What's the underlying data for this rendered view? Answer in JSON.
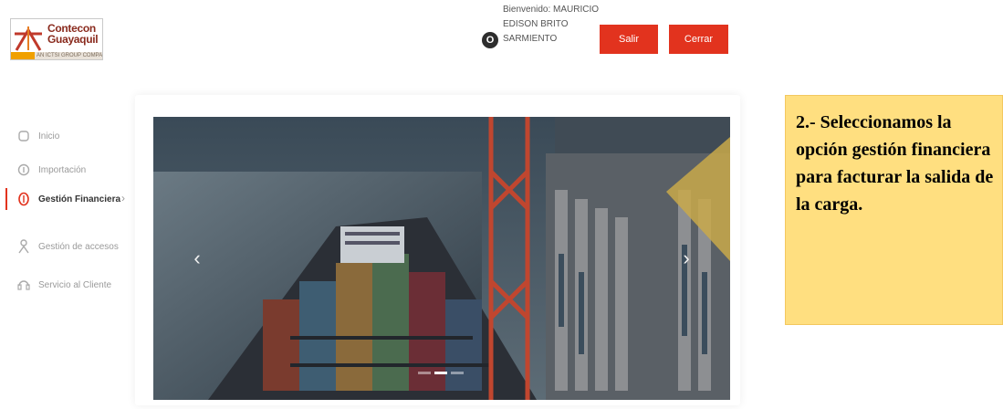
{
  "header": {
    "logo": {
      "line1": "Contecon",
      "line2": "Guayaquil",
      "tagline": "AN ICTSI GROUP COMPANY"
    },
    "user": {
      "avatar_letter": "O",
      "lines": [
        "Bienvenido: MAURICIO",
        "EDISON BRITO",
        "SARMIENTO"
      ]
    },
    "buttons": {
      "salir": "Salir",
      "cerrar": "Cerrar"
    }
  },
  "nav": {
    "items": [
      {
        "label": "Inicio",
        "icon": "home-icon"
      },
      {
        "label": "Importación",
        "icon": "import-icon"
      },
      {
        "label": "Gestión Financiera",
        "icon": "finance-icon",
        "active": true
      },
      {
        "label": "Gestión de accesos",
        "icon": "access-icon"
      },
      {
        "label": "Servicio al Cliente",
        "icon": "customer-service-icon"
      }
    ],
    "chevron": "›"
  },
  "carousel": {
    "image": "container port aerial photo",
    "prev": "‹",
    "next": "›",
    "slides": 3,
    "active_slide": 2
  },
  "callout": {
    "text": "2.- Seleccionamos la opción gestión financiera para facturar la salida de la carga."
  },
  "colors": {
    "accent": "#e2331e",
    "callout_bg": "#ffdf80",
    "callout_arrow": "#c9a94a"
  }
}
